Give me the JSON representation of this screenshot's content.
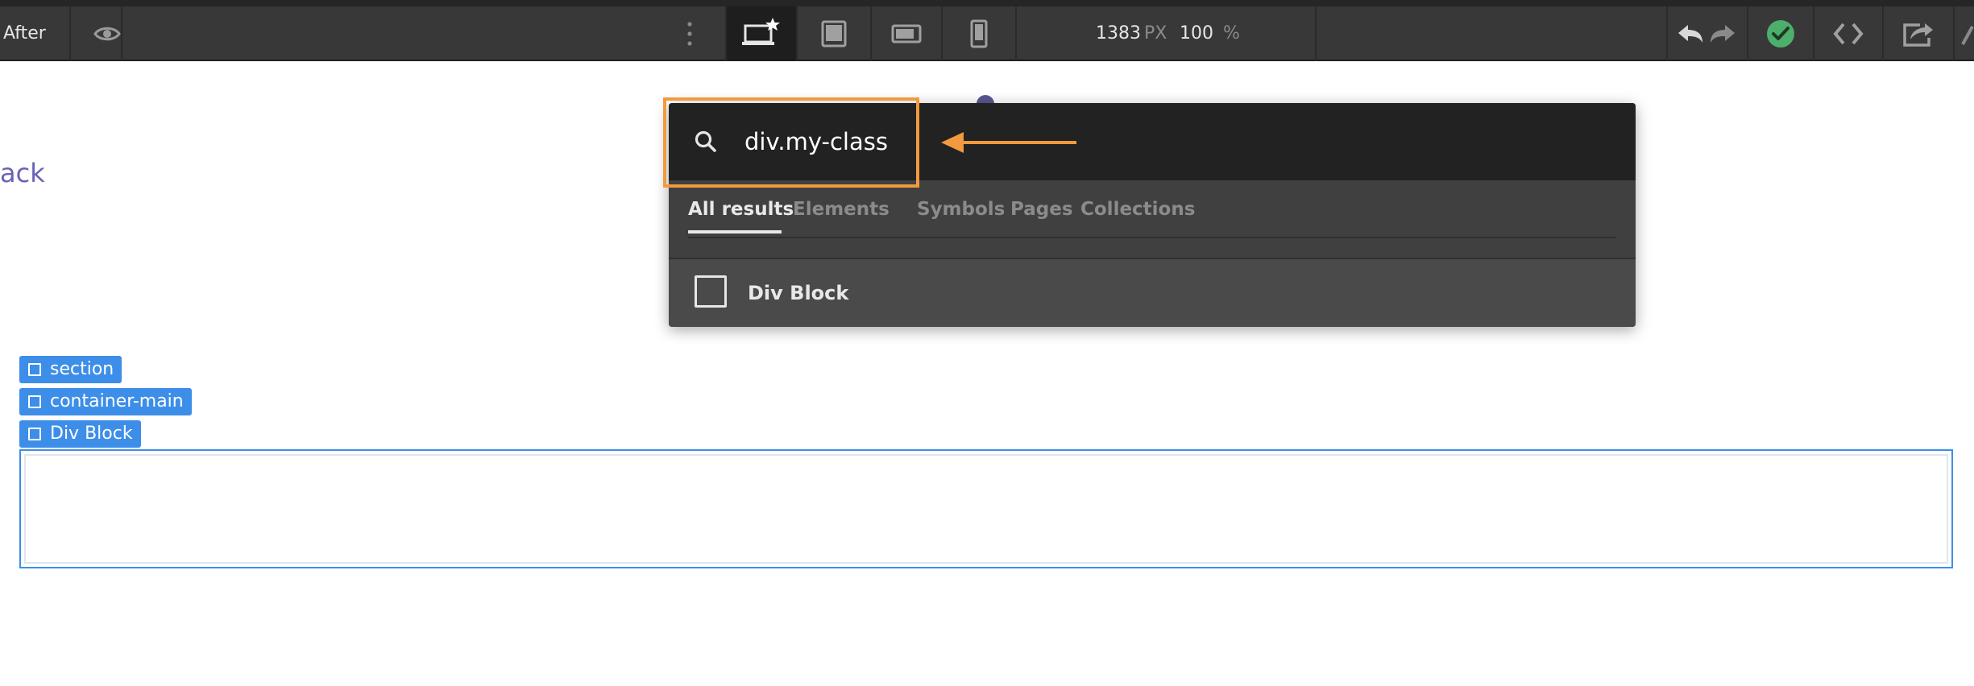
{
  "toolbar": {
    "after_label": "After",
    "width_value": "1383",
    "width_unit": "PX",
    "zoom_value": "100",
    "zoom_unit": "%",
    "devices": [
      "desktop",
      "tablet",
      "mobile-landscape",
      "mobile-portrait"
    ],
    "active_device": "desktop"
  },
  "canvas": {
    "edge_text": "ack",
    "breadcrumbs": [
      "section",
      "container-main",
      "Div Block"
    ]
  },
  "search": {
    "query": "div.my-class",
    "tabs": [
      "All results",
      "Elements",
      "Symbols",
      "Pages",
      "Collections"
    ],
    "active_tab": "All results",
    "results": [
      {
        "label": "Div Block",
        "icon": "div-block-icon"
      }
    ]
  },
  "colors": {
    "toolbar_bg": "#383838",
    "palette_bg": "#222222",
    "accent_blue": "#3d8ee8",
    "annotation_orange": "#f19a3e",
    "publish_green": "#4caf6b"
  }
}
